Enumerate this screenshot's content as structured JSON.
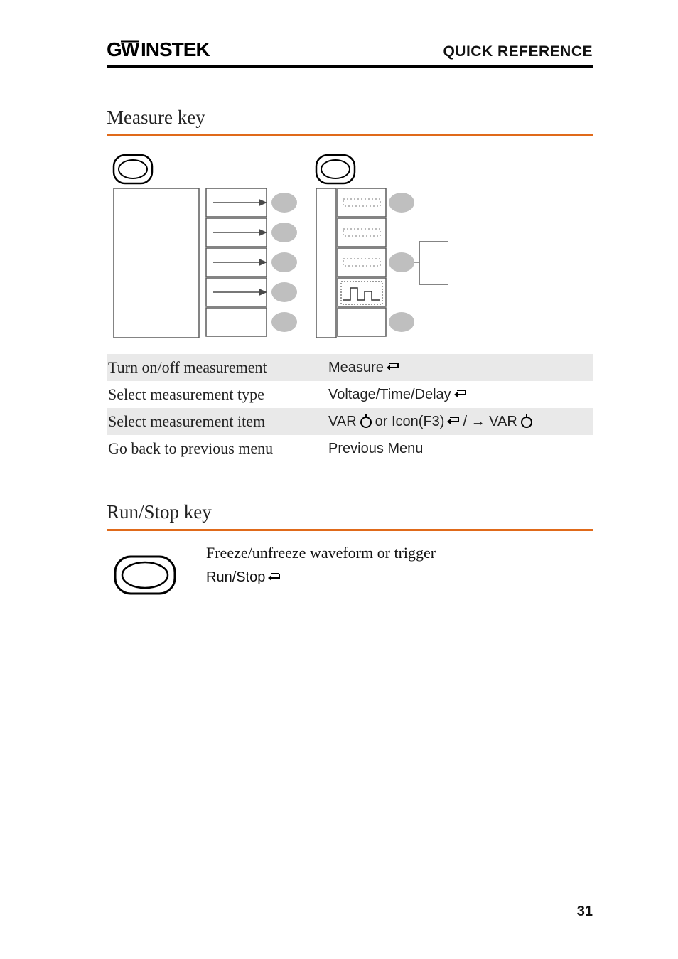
{
  "header": {
    "logo": "GWINSTEK",
    "right": "QUICK REFERENCE"
  },
  "section1": {
    "title": "Measure key",
    "rows": [
      {
        "label": "Turn on/off measurement",
        "action_pre": "Measure",
        "enter": true,
        "shade": true
      },
      {
        "label": "Select measurement type",
        "action_pre": "Voltage/Time/Delay",
        "enter": true,
        "shade": false
      },
      {
        "label": "Select measurement item",
        "complex": true,
        "shade": true,
        "p1": "VAR",
        "knob1": true,
        "p2": " or Icon(F3)",
        "enter2": true,
        "p3": "/ → VAR",
        "knob2": true
      },
      {
        "label": "Go back to previous menu",
        "action_pre": "Previous Menu",
        "shade": false
      }
    ]
  },
  "section2": {
    "title": "Run/Stop key",
    "desc": "Freeze/unfreeze waveform or trigger",
    "key": "Run/Stop"
  },
  "page_number": "31"
}
